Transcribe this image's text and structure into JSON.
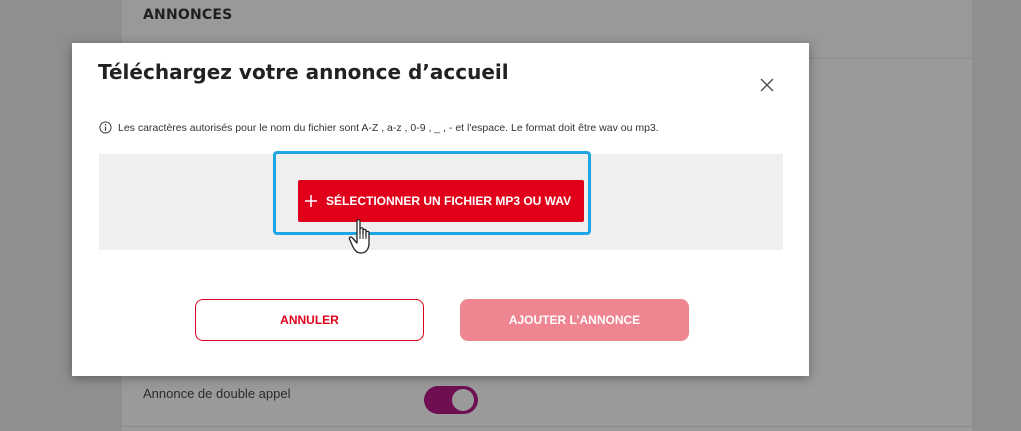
{
  "background": {
    "section_title": "ANNONCES",
    "row_label": "Annonce de double appel",
    "toggle_state": "on"
  },
  "modal": {
    "title": "Téléchargez votre annonce d’accueil",
    "info_text": "Les caractères autorisés pour le nom du fichier sont A-Z , a-z , 0-9 , _ , - et l'espace. Le format doit être wav ou mp3.",
    "select_file_label": "SÉLECTIONNER UN FICHIER MP3 OU WAV",
    "cancel_label": "ANNULER",
    "add_label": "AJOUTER L’ANNONCE",
    "icons": {
      "close": "close-icon",
      "info": "info-icon",
      "plus": "plus-icon",
      "cursor": "hand-pointer-icon"
    }
  },
  "colors": {
    "accent": "#e0001a",
    "accent_disabled": "#ef8590",
    "focus_ring": "#1ea6e4",
    "toggle": "#6e0f52"
  }
}
